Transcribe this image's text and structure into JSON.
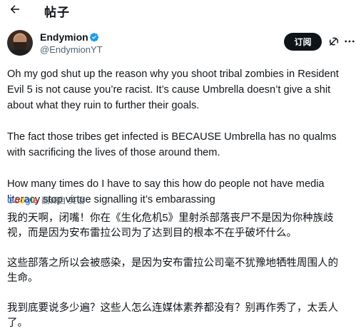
{
  "header": {
    "title": "帖子",
    "back_icon": "arrow-left-icon"
  },
  "author": {
    "display_name": "Endymion",
    "handle": "@EndymionYT",
    "verified_color": "#1d9bf0"
  },
  "actions": {
    "subscribe_label": "订阅",
    "grok_icon": "grok-icon",
    "more_icon": "more-icon"
  },
  "tweet": {
    "paragraphs": [
      "Oh my god shut up the reason why you shoot tribal zombies in Resident Evil 5 is not cause you’re racist. It’s cause Umbrella doesn’t give a shit about what they ruin to further their goals.",
      "The fact those tribes get infected is BECAUSE Umbrella has no qualms with sacrificing the lives of those around them.",
      "How many times do I have to say this how do people not have media literacy stop virtue signalling it’s embarassing"
    ]
  },
  "translation": {
    "provider": "Google",
    "label": "翻译自 英语",
    "paragraphs": [
      "我的天啊，闭嘴！你在《生化危机5》里射杀部落丧尸不是因为你种族歧视，而是因为安布雷拉公司为了达到目的根本不在乎破坏什么。",
      "这些部落之所以会被感染，是因为安布雷拉公司毫不犹豫地牺牲周围人的生命。",
      "我到底要说多少遍？这些人怎么连媒体素养都没有？别再作秀了，太丢人了。"
    ]
  }
}
